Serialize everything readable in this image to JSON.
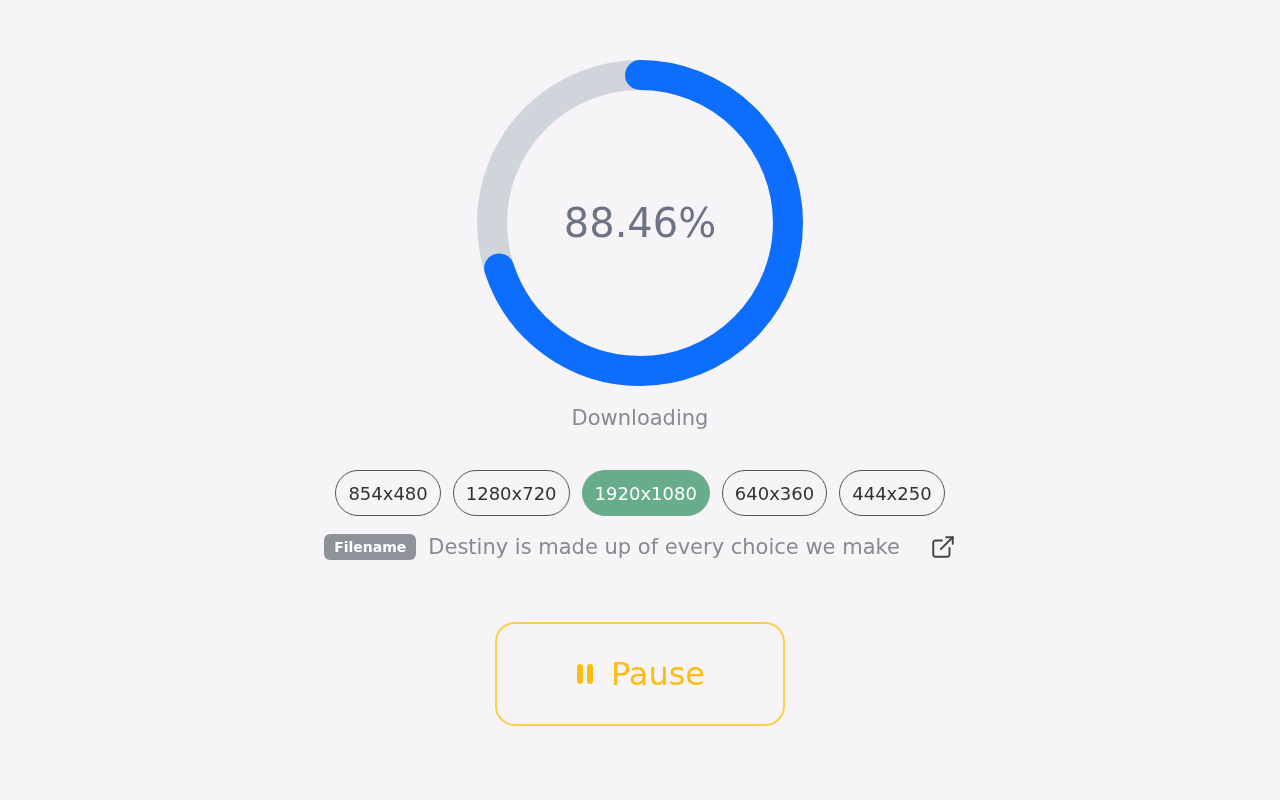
{
  "progress": {
    "level": 0.7,
    "percent": "88.46%",
    "status": "Downloading"
  },
  "resolutions": [
    {
      "label": "854x480",
      "selected": false
    },
    {
      "label": "1280x720",
      "selected": false
    },
    {
      "label": "1920x1080",
      "selected": true
    },
    {
      "label": "640x360",
      "selected": false
    },
    {
      "label": "444x250",
      "selected": false
    }
  ],
  "file": {
    "tag": "Filename",
    "name": "Destiny is made up of every choice we make"
  },
  "action_button": {
    "label": "Pause"
  }
}
